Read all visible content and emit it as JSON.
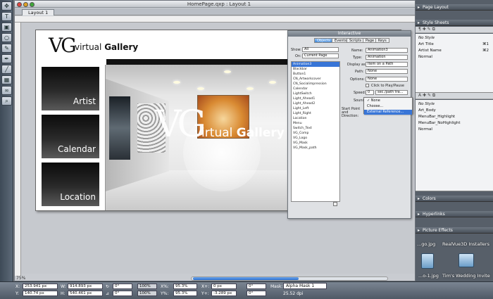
{
  "window": {
    "title": "HomePage.qxp : Layout 1",
    "layout_tab": "Layout 1"
  },
  "tools": [
    "move",
    "text",
    "picture",
    "oval",
    "bezier",
    "pen",
    "line",
    "table",
    "link",
    "zoom"
  ],
  "document": {
    "logo_mark": "VG",
    "logo_text_light": "virtual",
    "logo_text_bold": "Gallery",
    "nav": [
      "Artist",
      "Calendar",
      "Location"
    ],
    "overlay_text_light": "virtual",
    "overlay_text_bold": "Gallery"
  },
  "interactive": {
    "title": "Interactive",
    "tabs": [
      "Objects",
      "Events",
      "Scripts",
      "Page",
      "Keys"
    ],
    "show_label": "Show:",
    "show_value": "All",
    "on_label": "On:",
    "on_value": "Current Page",
    "objects": [
      "Animation3",
      "Blackbar",
      "Button1",
      "CN_Artworkcover",
      "CN_Socialimpression",
      "Calendar",
      "LightSwitch",
      "Light_Ahead1",
      "Light_Ahead2",
      "Light_Left",
      "Light_Right",
      "Location",
      "Menu",
      "Switch_Text",
      "VG_Comp",
      "VG_Logo",
      "VG_Mask",
      "VG_Mask_path"
    ],
    "name_label": "Name:",
    "name_value": "Animation3",
    "type_label": "Type:",
    "type_value": "Animation",
    "display_label": "Display as:",
    "display_value": "Item on a Path",
    "path_label": "Path:",
    "path_value": "None",
    "options_label": "Options:",
    "options_value": "None",
    "click_to_play": "Click to Play/Pause",
    "speed_label": "Speed:",
    "speed_value": "0",
    "speed_unit": "sec./path tra...",
    "sound_label": "Sound:",
    "start_label": "Start Point and Direction:"
  },
  "sound_menu": [
    "None",
    "Choose...",
    "External Reference..."
  ],
  "panels": {
    "page_layout": "Page Layout",
    "style_sheets": "Style Sheets",
    "paragraph_styles": [
      {
        "name": "No Style",
        "key": ""
      },
      {
        "name": "Art Title",
        "key": "⌘1"
      },
      {
        "name": "Artist Name",
        "key": "⌘2"
      },
      {
        "name": "Normal",
        "key": ""
      }
    ],
    "character_styles": [
      {
        "name": "No Style"
      },
      {
        "name": "Art_Body"
      },
      {
        "name": "MenuBar_Highlight"
      },
      {
        "name": "MenuBar_NoHighlight"
      },
      {
        "name": "Normal"
      }
    ],
    "colors": "Colors",
    "hyperlinks": "Hyperlinks",
    "picture_effects": "Picture Effects"
  },
  "desktop": {
    "files": [
      {
        "label": "...go.jpg"
      },
      {
        "label": "RealVue3D Installers"
      },
      {
        "label": "...o-1.jpg"
      },
      {
        "label": "Tim's Wedding Invite"
      }
    ]
  },
  "measurements": {
    "x_label": "X:",
    "x_value": "253.941 px",
    "y_label": "Y:",
    "y_value": "140.74 px",
    "w_label": "W:",
    "w_value": "914.893 px",
    "h_label": "H:",
    "h_value": "540.461 px",
    "rot1": "0°",
    "rot2": "0°",
    "pct1": "100%",
    "pct2": "100%",
    "xpct_label": "X%:",
    "xpct_value": "95.3%",
    "ypct_label": "Y%:",
    "ypct_value": "95.3%",
    "xplus_label": "X+:",
    "xplus_value": "0 px",
    "yplus_label": "Y+:",
    "yplus_value": "-3.289 px",
    "rot3": "0°",
    "rot4": "0°",
    "mask_label": "Mask:",
    "mask_value": "Alpha Mask 1",
    "dpi": "25.52 dpi"
  },
  "page_counter": "75%",
  "colors": {
    "accent": "#3875d7",
    "titlebar": "#c3c7cc"
  }
}
